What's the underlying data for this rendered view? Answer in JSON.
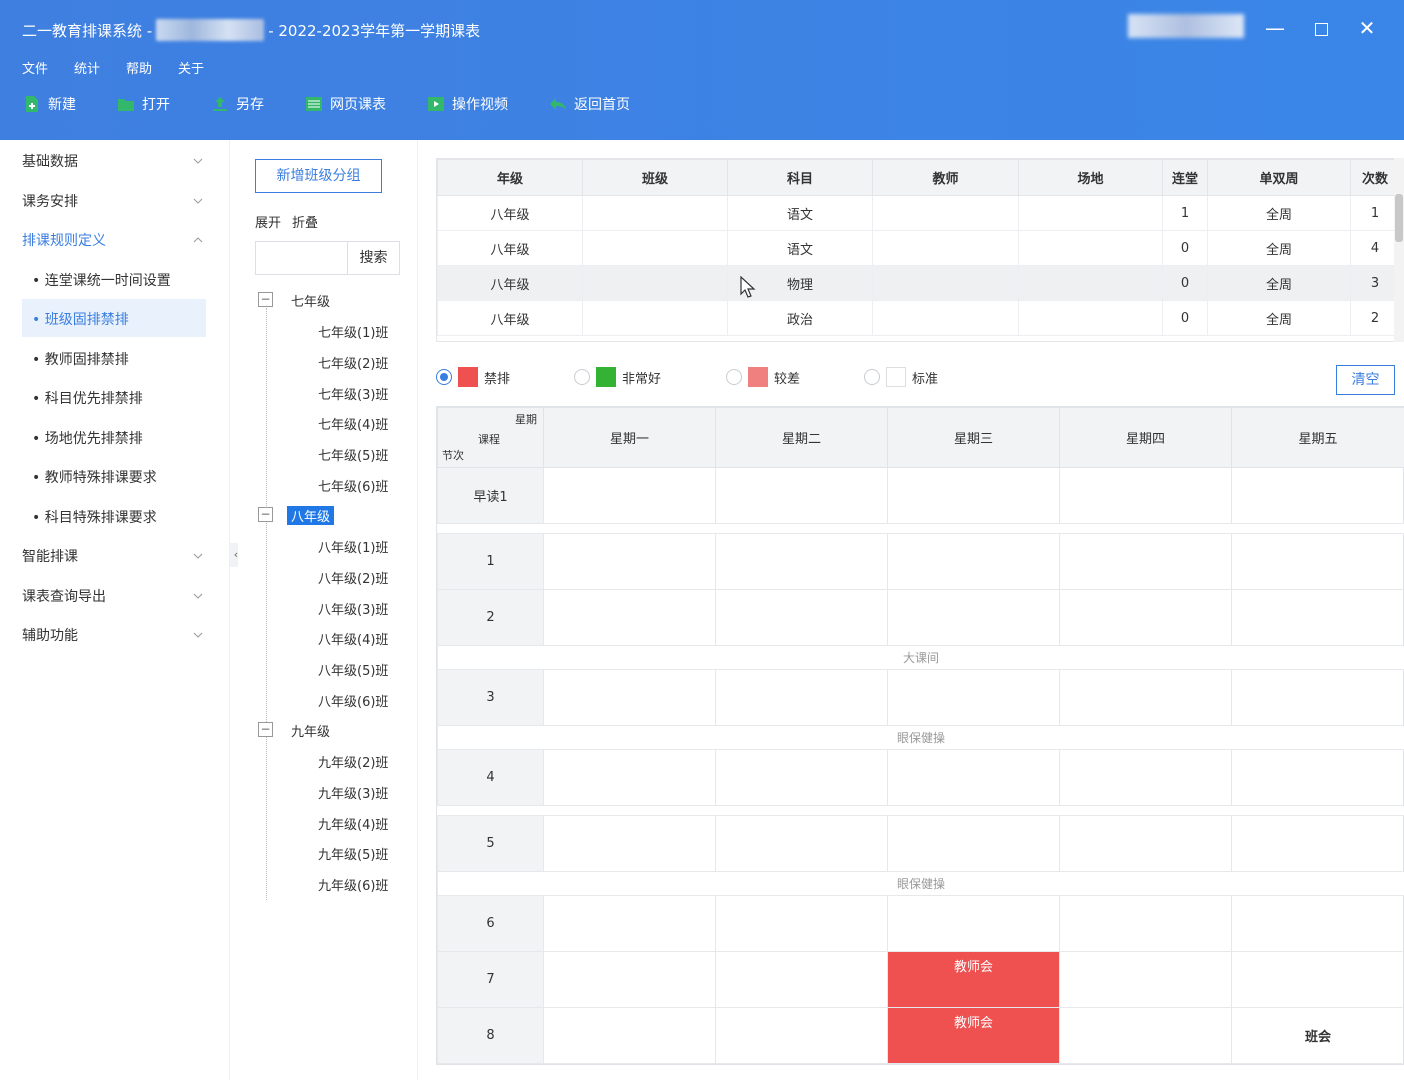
{
  "window": {
    "title_left": "二一教育排课系统 -",
    "title_right": "- 2022-2023学年第一学期课表"
  },
  "menu": [
    "文件",
    "统计",
    "帮助",
    "关于"
  ],
  "toolbar": {
    "new": "新建",
    "open": "打开",
    "saveas": "另存",
    "webtable": "网页课表",
    "video": "操作视频",
    "home": "返回首页"
  },
  "sidebar": {
    "groups": [
      "基础数据",
      "课务安排",
      "排课规则定义",
      "智能排课",
      "课表查询导出",
      "辅助功能"
    ],
    "subitems": [
      "连堂课统一时间设置",
      "班级固排禁排",
      "教师固排禁排",
      "科目优先排禁排",
      "场地优先排禁排",
      "教师特殊排课要求",
      "科目特殊排课要求"
    ]
  },
  "mid": {
    "new_group": "新增班级分组",
    "expand": "展开",
    "fold": "折叠",
    "search_btn": "搜索",
    "search_placeholder": "",
    "tree": [
      {
        "label": "七年级",
        "children": [
          "七年级(1)班",
          "七年级(2)班",
          "七年级(3)班",
          "七年级(4)班",
          "七年级(5)班",
          "七年级(6)班"
        ]
      },
      {
        "label": "八年级",
        "children": [
          "八年级(1)班",
          "八年级(2)班",
          "八年级(3)班",
          "八年级(4)班",
          "八年级(5)班",
          "八年级(6)班"
        ]
      },
      {
        "label": "九年级",
        "children": [
          "九年级(2)班",
          "九年级(3)班",
          "九年级(4)班",
          "九年级(5)班",
          "九年级(6)班"
        ]
      }
    ]
  },
  "grid": {
    "headers": [
      "年级",
      "班级",
      "科目",
      "教师",
      "场地",
      "连堂",
      "单双周",
      "次数"
    ],
    "rows": [
      [
        "八年级",
        "",
        "语文",
        "",
        "",
        "1",
        "全周",
        "1"
      ],
      [
        "八年级",
        "",
        "语文",
        "",
        "",
        "0",
        "全周",
        "4"
      ],
      [
        "八年级",
        "",
        "物理",
        "",
        "",
        "0",
        "全周",
        "3"
      ],
      [
        "八年级",
        "",
        "政治",
        "",
        "",
        "0",
        "全周",
        "2"
      ]
    ]
  },
  "legend": {
    "ban": "禁排",
    "verygood": "非常好",
    "poor": "较差",
    "standard": "标准",
    "clear": "清空",
    "colors": {
      "ban": "#ef5050",
      "verygood": "#34b233",
      "poor": "#f08080",
      "standard": "#ffffff",
      "accent": "#3a7ee0"
    }
  },
  "schedule": {
    "corner": {
      "week": "星期",
      "course": "课程",
      "period": "节次"
    },
    "days": [
      "星期一",
      "星期二",
      "星期三",
      "星期四",
      "星期五"
    ],
    "breaks": {
      "big": "大课间",
      "eye1": "眼保健操",
      "eye2": "眼保健操"
    },
    "periods": [
      "早读1",
      "1",
      "2",
      "3",
      "4",
      "5",
      "6",
      "7",
      "8"
    ],
    "cells": {
      "p7_wed": "教师会",
      "p8_wed": "教师会",
      "p8_fri": "班会"
    }
  }
}
